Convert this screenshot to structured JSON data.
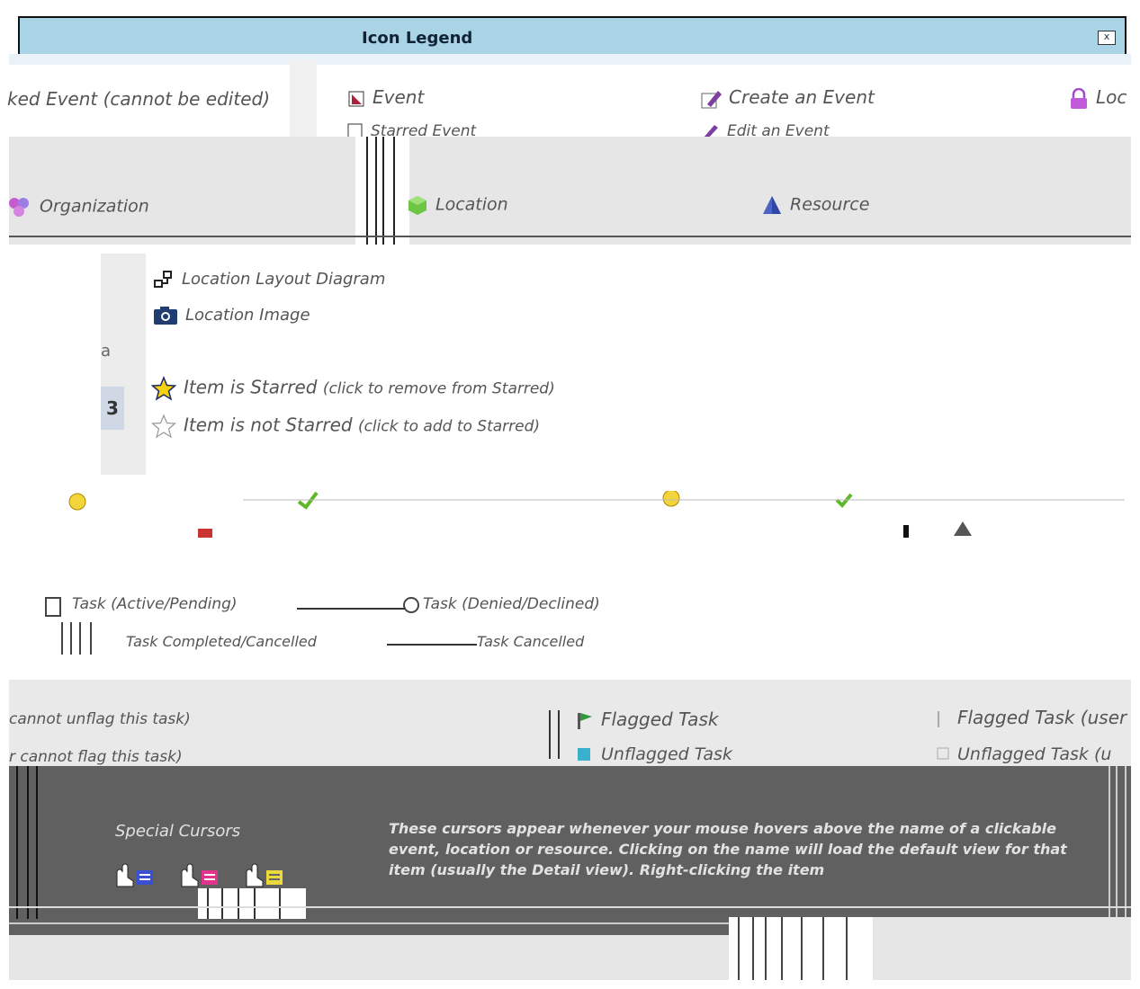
{
  "window": {
    "title": "Icon Legend",
    "close_label": "x"
  },
  "legend": {
    "locked_event": "ked Event (cannot be edited)",
    "event": "Event",
    "create_event": "Create an Event",
    "loc_partial": "Loc",
    "starred_event": "Starred Event",
    "edit_event": "Edit an Event",
    "organization": "Organization",
    "location": "Location",
    "resource": "Resource",
    "layout_diagram": "Location Layout Diagram",
    "location_image": "Location Image",
    "item_starred": "Item is Starred",
    "item_starred_hint": "(click to remove from Starred)",
    "item_not_starred": "Item is not Starred",
    "item_not_starred_hint": "(click to add to Starred)",
    "task_active": "Task (Active/Pending)",
    "task_denied": "Task (Denied/Declined)",
    "task_completed": "Task Completed/Cancelled",
    "task_cancelled": "Task Cancelled",
    "cannot_unflag": "cannot unflag this task)",
    "cannot_flag": "r cannot flag this task)",
    "flagged_task": "Flagged Task",
    "flagged_task_user": "Flagged Task (user",
    "unflagged_task": "Unflagged Task",
    "unflagged_task_user": "Unflagged Task (u"
  },
  "special_cursors": {
    "title": "Special Cursors",
    "description": "These cursors appear whenever your mouse hovers above the name of a clickable event, location or resource. Clicking on the name will load the default view for that item (usually the Detail view). Right-clicking the item"
  },
  "colors": {
    "title_bar": "#a9d4e6",
    "dark_panel": "#606060",
    "star": "#f5d20b",
    "accent_purple": "#7b3fa0",
    "cursor_blue": "#3b4fd1",
    "cursor_pink": "#e0338a",
    "cursor_yellow": "#e9d93a"
  }
}
